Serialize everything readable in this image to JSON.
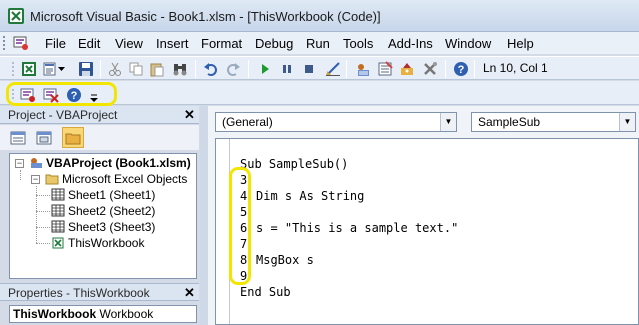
{
  "window": {
    "title": "Microsoft Visual Basic - Book1.xlsm - [ThisWorkbook (Code)]"
  },
  "menu": [
    "File",
    "Edit",
    "View",
    "Insert",
    "Format",
    "Debug",
    "Run",
    "Tools",
    "Add-Ins",
    "Window",
    "Help"
  ],
  "toolbar": {
    "position": "Ln 10, Col 1",
    "buttons": [
      "view-excel-icon",
      "insert-module-icon",
      "save-icon",
      "cut-icon",
      "copy-icon",
      "paste-icon",
      "find-icon",
      "undo-icon",
      "redo-icon",
      "run-icon",
      "break-icon",
      "reset-icon",
      "design-mode-icon",
      "project-explorer-icon",
      "properties-icon",
      "object-browser-icon",
      "toolbox-icon",
      "help-icon"
    ]
  },
  "edit_toolbar": {
    "buttons": [
      "toggle-breakpoint-icon",
      "clear-all-breakpoints-icon",
      "help-icon",
      "dropdown-icon"
    ]
  },
  "project_panel": {
    "title": "Project - VBAProject",
    "tree": {
      "root": "VBAProject (Book1.xlsm)",
      "folder": "Microsoft Excel Objects",
      "items": [
        "Sheet1 (Sheet1)",
        "Sheet2 (Sheet2)",
        "Sheet3 (Sheet3)",
        "ThisWorkbook"
      ]
    }
  },
  "properties_panel": {
    "title": "Properties - ThisWorkbook",
    "object_name": "ThisWorkbook",
    "object_type": "Workbook"
  },
  "code_window": {
    "object_combo": "(General)",
    "procedure_combo": "SampleSub",
    "lines": [
      {
        "num": "",
        "text": "Sub SampleSub()"
      },
      {
        "num": "3",
        "text": ""
      },
      {
        "num": "4",
        "text": "Dim s As String"
      },
      {
        "num": "5",
        "text": ""
      },
      {
        "num": "6",
        "text": "s = \"This is a sample text.\""
      },
      {
        "num": "7",
        "text": ""
      },
      {
        "num": "8",
        "text": "MsgBox s"
      },
      {
        "num": "9",
        "text": ""
      },
      {
        "num": "",
        "text": "End Sub"
      }
    ]
  },
  "colors": {
    "highlight": "#f2e600",
    "toolbar_bg": "#e8eef7",
    "titlebar_bg": "#c7d6ea"
  }
}
